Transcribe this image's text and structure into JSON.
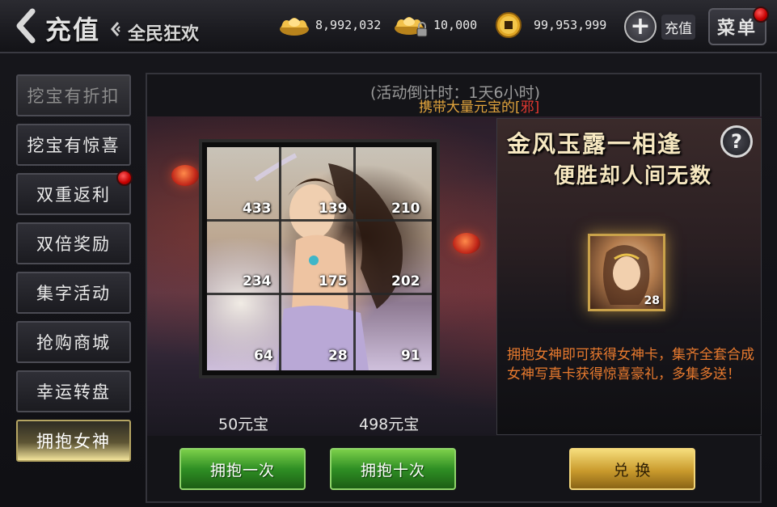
{
  "header": {
    "title": "充值",
    "subtitle": "全民狂欢",
    "currencies": [
      {
        "icon": "gold-ingot-icon",
        "value": "8,992,032"
      },
      {
        "icon": "locked-gold-ingot-icon",
        "value": "10,000"
      },
      {
        "icon": "copper-coin-icon",
        "value": "99,953,999"
      }
    ],
    "recharge_label": "充值",
    "menu_label": "菜单"
  },
  "sidebar": {
    "items": [
      {
        "label": "挖宝有折扣",
        "state": "dim"
      },
      {
        "label": "挖宝有惊喜",
        "state": "normal"
      },
      {
        "label": "双重返利",
        "state": "normal",
        "badge": true
      },
      {
        "label": "双倍奖励",
        "state": "normal"
      },
      {
        "label": "集字活动",
        "state": "normal"
      },
      {
        "label": "抢购商城",
        "state": "normal"
      },
      {
        "label": "幸运转盘",
        "state": "normal"
      },
      {
        "label": "拥抱女神",
        "state": "active"
      }
    ]
  },
  "main": {
    "countdown": "(活动倒计时：1天6小时)",
    "notice_prefix": "携带大量元宝的[",
    "notice_highlight": "邪]",
    "puzzle": {
      "cells": [
        "433",
        "139",
        "210",
        "234",
        "175",
        "202",
        "64",
        "28",
        "91"
      ]
    },
    "prices": {
      "once": "50元宝",
      "ten": "498元宝"
    },
    "buttons": {
      "hug_once": "拥抱一次",
      "hug_ten": "拥抱十次",
      "exchange": "兑 换"
    },
    "promo": {
      "title_line1": "金风玉露一相逢",
      "title_line2": "便胜却人间无数",
      "help": "?",
      "card_count": "28",
      "description": "拥抱女神即可获得女神卡，集齐全套合成女神写真卡获得惊喜豪礼，多集多送！"
    }
  },
  "colors": {
    "accent_gold": "#f5dc7a",
    "button_green": "#2f8f24",
    "description_orange": "#e87a2e",
    "notice_orange": "#e0a33c",
    "notice_red": "#e0372f"
  }
}
